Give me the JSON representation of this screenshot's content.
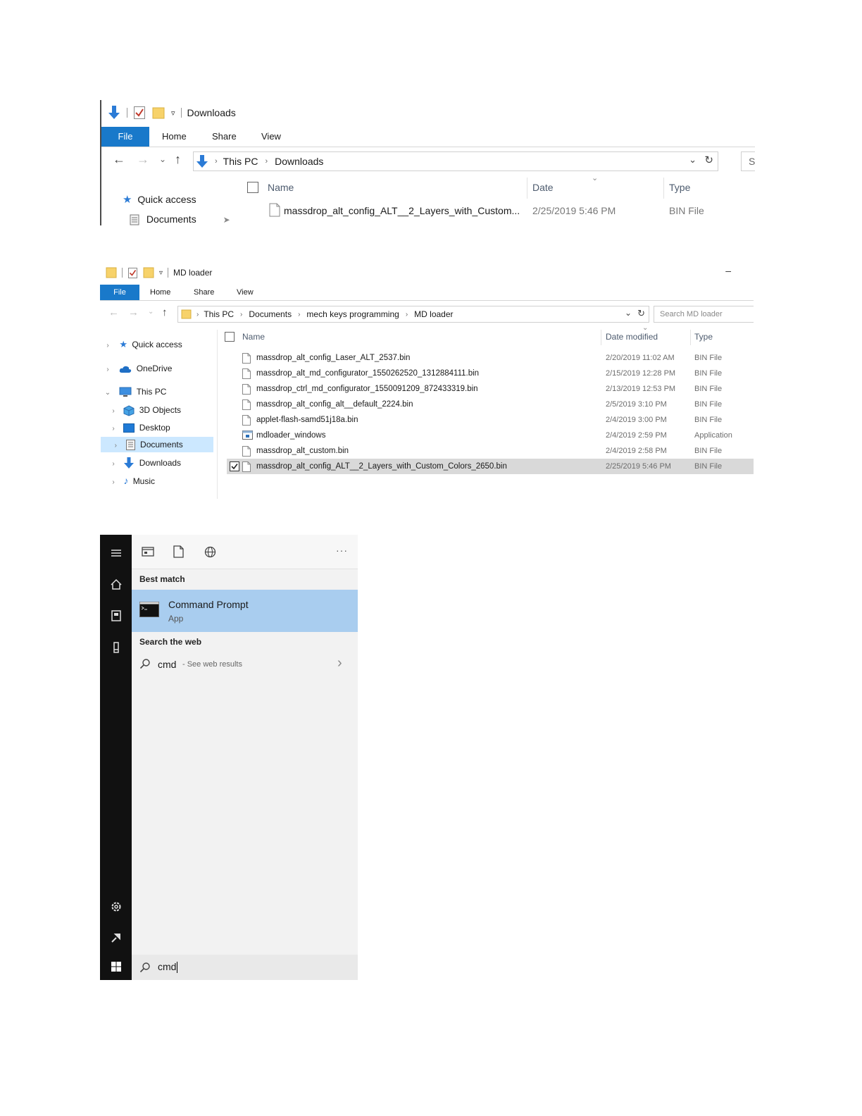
{
  "explorer1": {
    "title": "Downloads",
    "tabs": [
      "File",
      "Home",
      "Share",
      "View"
    ],
    "breadcrumb": [
      "This PC",
      "Downloads"
    ],
    "search_placeholder": "S",
    "nav": [
      "Quick access",
      "Documents"
    ],
    "columns": [
      "Name",
      "Date",
      "Type"
    ],
    "file": {
      "name": "massdrop_alt_config_ALT__2_Layers_with_Custom...",
      "date": "2/25/2019 5:46 PM",
      "type": "BIN File"
    }
  },
  "explorer2": {
    "title": "MD loader",
    "minimize": "–",
    "tabs": [
      "File",
      "Home",
      "Share",
      "View"
    ],
    "breadcrumb": [
      "This PC",
      "Documents",
      "mech keys programming",
      "MD loader"
    ],
    "search_placeholder": "Search MD loader",
    "nav": [
      {
        "label": "Quick access"
      },
      {
        "label": "OneDrive"
      },
      {
        "label": "This PC"
      },
      {
        "label": "3D Objects"
      },
      {
        "label": "Desktop"
      },
      {
        "label": "Documents",
        "selected": true
      },
      {
        "label": "Downloads"
      },
      {
        "label": "Music"
      }
    ],
    "columns": [
      "Name",
      "Date modified",
      "Type"
    ],
    "files": [
      {
        "name": "massdrop_alt_config_Laser_ALT_2537.bin",
        "date": "2/20/2019 11:02 AM",
        "type": "BIN File"
      },
      {
        "name": "massdrop_alt_md_configurator_1550262520_1312884111.bin",
        "date": "2/15/2019 12:28 PM",
        "type": "BIN File"
      },
      {
        "name": "massdrop_ctrl_md_configurator_1550091209_872433319.bin",
        "date": "2/13/2019 12:53 PM",
        "type": "BIN File"
      },
      {
        "name": "massdrop_alt_config_alt__default_2224.bin",
        "date": "2/5/2019 3:10 PM",
        "type": "BIN File"
      },
      {
        "name": "applet-flash-samd51j18a.bin",
        "date": "2/4/2019 3:00 PM",
        "type": "BIN File"
      },
      {
        "name": "mdloader_windows",
        "date": "2/4/2019 2:59 PM",
        "type": "Application"
      },
      {
        "name": "massdrop_alt_custom.bin",
        "date": "2/4/2019 2:58 PM",
        "type": "BIN File"
      },
      {
        "name": "massdrop_alt_config_ALT__2_Layers_with_Custom_Colors_2650.bin",
        "date": "2/25/2019 5:46 PM",
        "type": "BIN File",
        "selected": true
      }
    ]
  },
  "start": {
    "more": "···",
    "best_match_label": "Best match",
    "best_match": {
      "title": "Command Prompt",
      "subtitle": "App"
    },
    "web_label": "Search the web",
    "web_query": "cmd",
    "web_hint": "- See web results",
    "search_value": "cmd"
  },
  "colors": {
    "accent": "#1979ca",
    "selection": "#cce8ff",
    "best_match_bg": "#a9cdef",
    "rail": "#111111"
  }
}
